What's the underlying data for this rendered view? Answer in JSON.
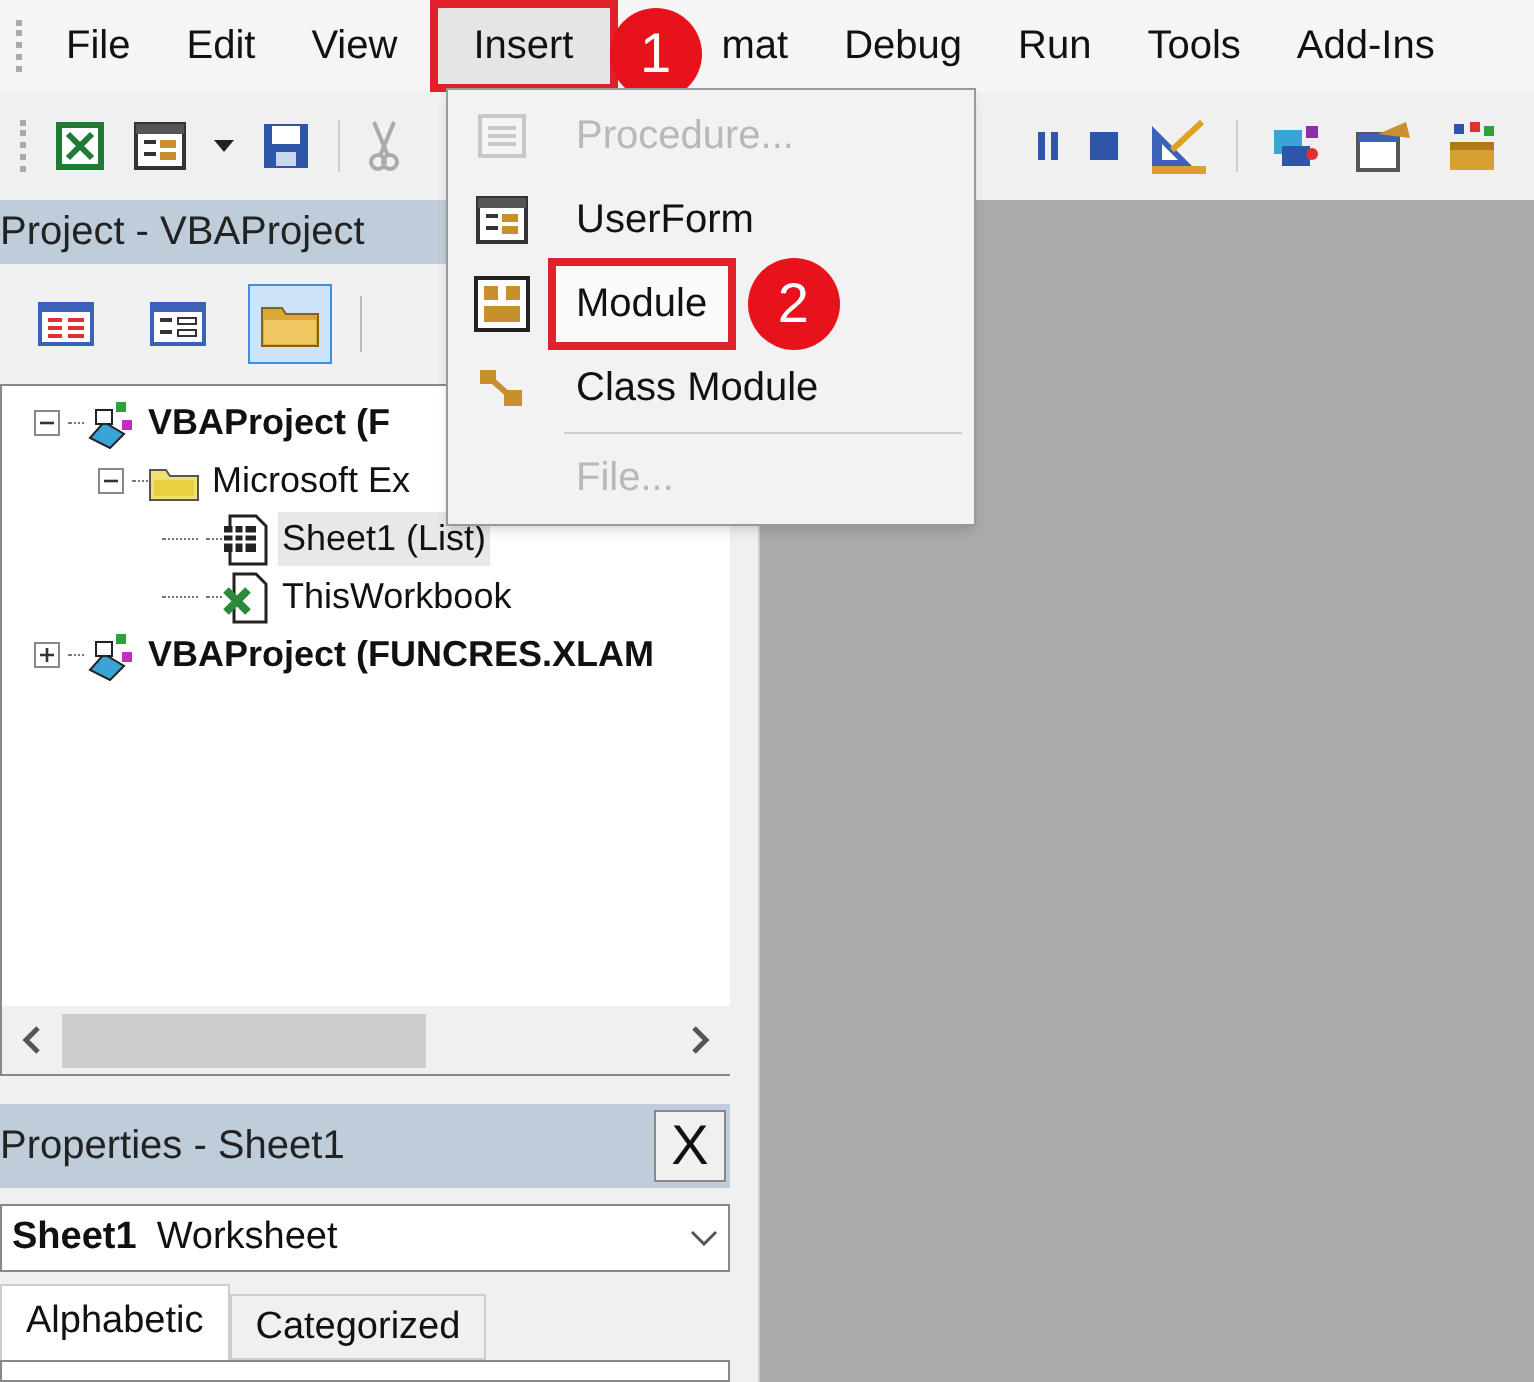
{
  "menu_bar": [
    {
      "label": "File",
      "selected": false
    },
    {
      "label": "Edit",
      "selected": false
    },
    {
      "label": "View",
      "selected": false
    },
    {
      "label": "Insert",
      "selected": true
    },
    {
      "label": "mat",
      "selected": false
    },
    {
      "label": "Debug",
      "selected": false
    },
    {
      "label": "Run",
      "selected": false
    },
    {
      "label": "Tools",
      "selected": false
    },
    {
      "label": "Add-Ins",
      "selected": false
    }
  ],
  "insert_menu": [
    {
      "label": "Procedure...",
      "disabled": true,
      "kind": "procedure"
    },
    {
      "label": "UserForm",
      "disabled": false,
      "kind": "userform"
    },
    {
      "label": "Module",
      "disabled": false,
      "kind": "module"
    },
    {
      "label": "Class Module",
      "disabled": false,
      "kind": "class"
    },
    {
      "label": "File...",
      "disabled": true,
      "kind": "file"
    }
  ],
  "callouts": [
    {
      "label": "1"
    },
    {
      "label": "2"
    }
  ],
  "project_panel": {
    "title": "Project - VBAProject",
    "tools": [
      {
        "pressed": false
      },
      {
        "pressed": false
      },
      {
        "pressed": true
      }
    ],
    "tree": [
      {
        "label": "VBAProject (F",
        "kind": "project",
        "expanded": true,
        "selected": false,
        "children": [
          {
            "label": "Microsoft Ex",
            "kind": "folder",
            "expanded": true,
            "selected": false,
            "children": [
              {
                "label": "Sheet1 (List)",
                "kind": "sheet",
                "selected": true
              },
              {
                "label": "ThisWorkbook",
                "kind": "workbook",
                "selected": false
              }
            ]
          }
        ]
      },
      {
        "label": "VBAProject (FUNCRES.XLAM",
        "kind": "project",
        "expanded": false,
        "selected": false
      }
    ]
  },
  "properties_panel": {
    "title": "Properties - Sheet1",
    "close": "X",
    "object_name": "Sheet1",
    "object_type": "Worksheet",
    "tabs": [
      {
        "label": "Alphabetic",
        "selected": true
      },
      {
        "label": "Categorized",
        "selected": false
      }
    ]
  }
}
